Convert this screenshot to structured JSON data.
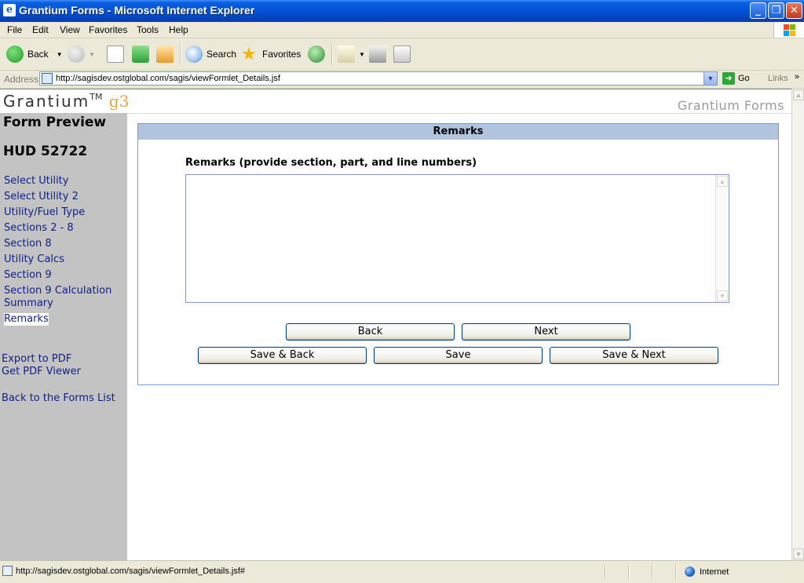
{
  "window": {
    "title": "Grantium Forms - Microsoft Internet Explorer",
    "controls": {
      "minimize": "_",
      "maximize": "❐",
      "close": "✕"
    }
  },
  "menu": [
    "File",
    "Edit",
    "View",
    "Favorites",
    "Tools",
    "Help"
  ],
  "toolbar": {
    "back": "Back",
    "search": "Search",
    "favorites": "Favorites"
  },
  "address": {
    "label": "Address",
    "url": "http://sagisdev.ostglobal.com/sagis/viewFormlet_Details.jsf",
    "go": "Go",
    "links": "Links"
  },
  "header": {
    "logo_text": "Grantium",
    "logo_tm": "TM",
    "logo_g3": "g3",
    "brand": "Grantium Forms"
  },
  "sidebar": {
    "title": "Form Preview",
    "form_id": "HUD 52722",
    "items": [
      {
        "label": "Select Utility"
      },
      {
        "label": "Select Utility 2"
      },
      {
        "label": "Utility/Fuel Type"
      },
      {
        "label": "Sections 2 - 8"
      },
      {
        "label": "Section 8"
      },
      {
        "label": "Utility Calcs"
      },
      {
        "label": "Section 9"
      },
      {
        "label": "Section 9 Calculation Summary"
      },
      {
        "label": "Remarks"
      }
    ],
    "export_pdf": "Export to PDF",
    "get_viewer": "Get PDF Viewer",
    "back_to_list": "Back to the Forms List"
  },
  "panel": {
    "header": "Remarks",
    "field_label": "Remarks (provide section, part, and line numbers)",
    "field_value": "",
    "buttons": {
      "back": "Back",
      "next": "Next",
      "save_back": "Save & Back",
      "save": "Save",
      "save_next": "Save & Next"
    }
  },
  "status": {
    "url": "http://sagisdev.ostglobal.com/sagis/viewFormlet_Details.jsf#",
    "zone": "Internet"
  }
}
